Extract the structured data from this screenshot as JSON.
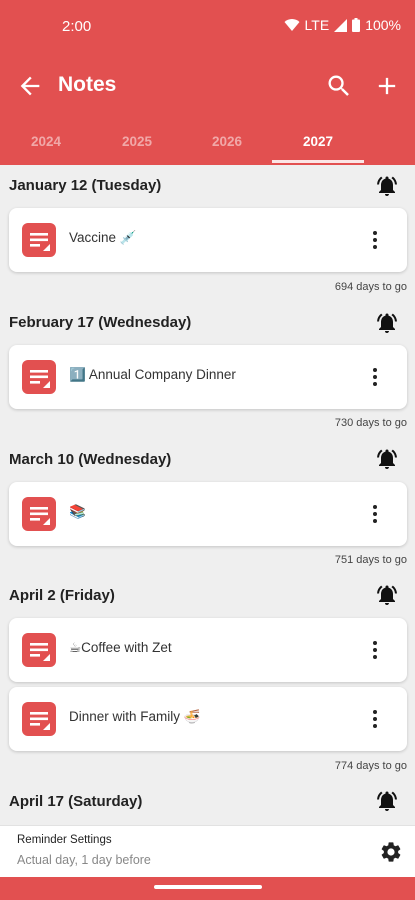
{
  "status_bar": {
    "time": "2:00",
    "network": "LTE",
    "battery": "100%"
  },
  "toolbar": {
    "title": "Notes"
  },
  "tabs": [
    {
      "label": "2024",
      "active": false
    },
    {
      "label": "2025",
      "active": false
    },
    {
      "label": "2026",
      "active": false
    },
    {
      "label": "2027",
      "active": true
    }
  ],
  "groups": [
    {
      "date": "January 12 (Tuesday)",
      "notes": [
        "Vaccine 💉"
      ],
      "days_to_go": "694 days to go"
    },
    {
      "date": "February 17 (Wednesday)",
      "notes": [
        "1️⃣ Annual Company Dinner"
      ],
      "days_to_go": "730 days to go"
    },
    {
      "date": "March 10 (Wednesday)",
      "notes": [
        "📚"
      ],
      "days_to_go": "751 days to go"
    },
    {
      "date": "April 2 (Friday)",
      "notes": [
        "☕Coffee with Zet",
        "Dinner with Family 🍜"
      ],
      "days_to_go": "774 days to go"
    },
    {
      "date": "April 17 (Saturday)",
      "notes": [],
      "days_to_go": ""
    }
  ],
  "reminder": {
    "title": "Reminder Settings",
    "subtitle": "Actual day, 1 day before"
  },
  "colors": {
    "accent": "#e25050",
    "background": "#efefef"
  }
}
